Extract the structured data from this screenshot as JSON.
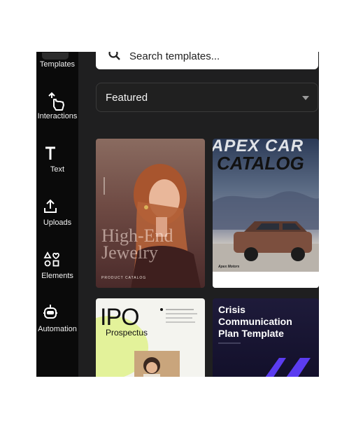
{
  "sidebar": {
    "items": [
      {
        "label": "Templates",
        "icon": "templates-icon"
      },
      {
        "label": "Interactions",
        "icon": "interactions-icon"
      },
      {
        "label": "Text",
        "icon": "text-icon"
      },
      {
        "label": "Uploads",
        "icon": "upload-icon"
      },
      {
        "label": "Elements",
        "icon": "elements-icon"
      },
      {
        "label": "Automation",
        "icon": "robot-icon"
      }
    ]
  },
  "search": {
    "placeholder": "Search templates..."
  },
  "filter": {
    "selected": "Featured"
  },
  "cards": [
    {
      "title_line1": "High-End",
      "title_line2": "Jewelry",
      "footer": "PRODUCT CATALOG"
    },
    {
      "title_top": "APEX CAR",
      "title_main": "CATALOG",
      "brand": "Apex Motors"
    },
    {
      "title": "IPO",
      "subtitle": "Prospectus"
    },
    {
      "title_line1": "Crisis",
      "title_line2": "Communication",
      "title_line3": "Plan Template"
    }
  ],
  "colors": {
    "accent": "#5b3cf0",
    "background": "#1f1f20",
    "sidebar": "#0a0a0a"
  }
}
